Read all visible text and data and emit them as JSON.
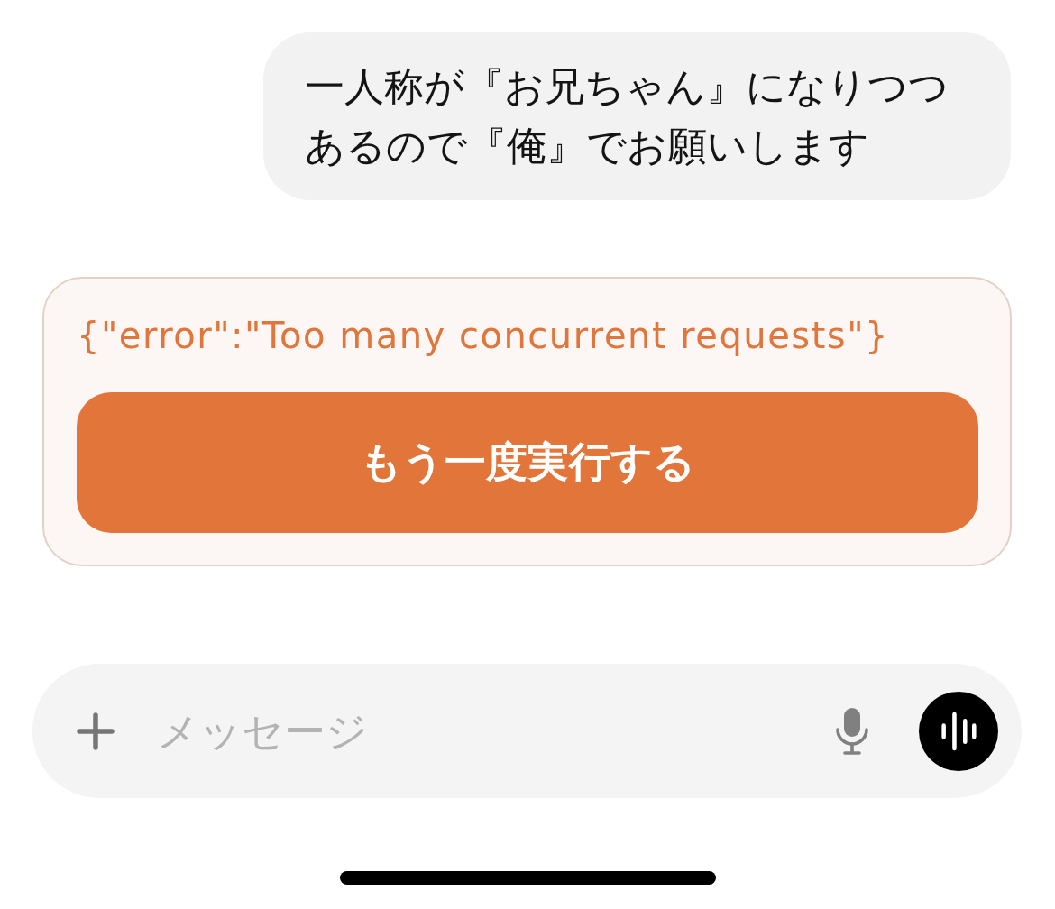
{
  "messages": [
    {
      "kind": "user",
      "text": "一人称が『お兄ちゃん』になりつつあるので『俺』でお願いします"
    }
  ],
  "error": {
    "message": "{\"error\":\"Too many concurrent requests\"}",
    "retry_button": "もう一度実行する"
  },
  "composer": {
    "placeholder": "メッセージ"
  }
}
